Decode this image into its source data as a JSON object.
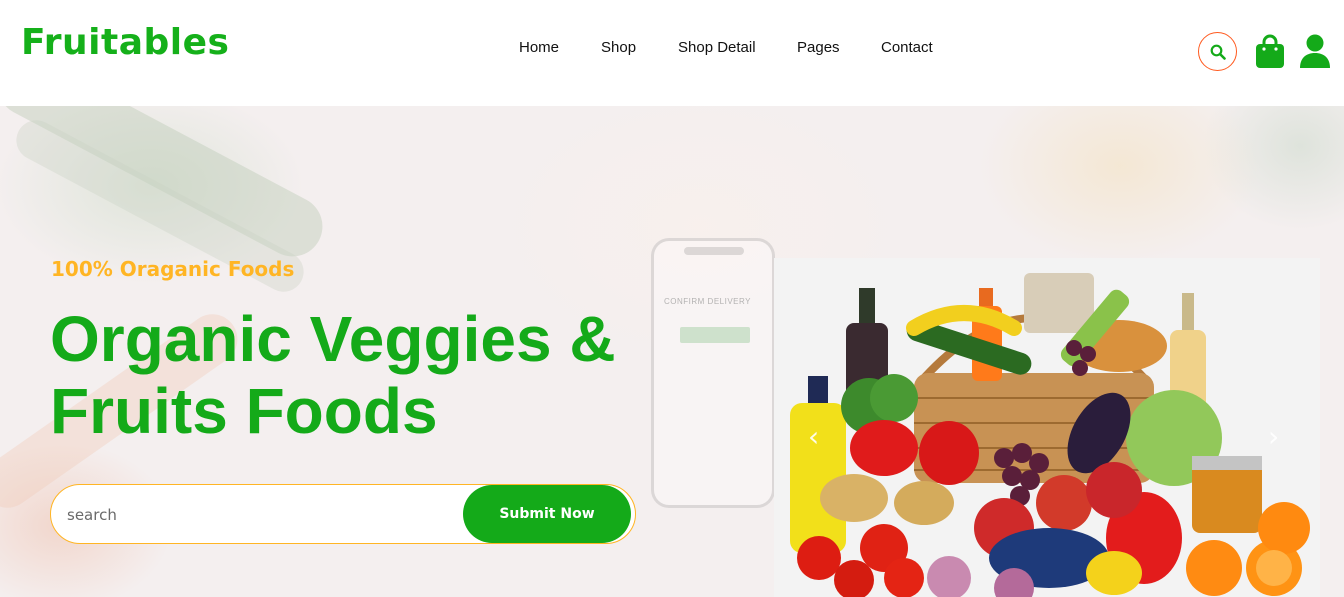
{
  "brand": {
    "name": "Fruitables",
    "color": "#15b01a"
  },
  "nav": {
    "items": [
      {
        "label": "Home"
      },
      {
        "label": "Shop"
      },
      {
        "label": "Shop Detail"
      },
      {
        "label": "Pages"
      },
      {
        "label": "Contact"
      }
    ]
  },
  "header_icons": {
    "search": "search-icon",
    "cart": "shopping-bag-icon",
    "account": "user-icon"
  },
  "hero": {
    "tagline": "100% Oraganic Foods",
    "headline_line1": "Organic Veggies &",
    "headline_line2": "Fruits Foods",
    "search_placeholder": "search",
    "submit_label": "Submit Now",
    "phone_text": "CONFIRM DELIVERY"
  },
  "carousel": {
    "prev": "‹",
    "next": "›"
  },
  "colors": {
    "primary": "#14aa19",
    "accent": "#ffb524",
    "search_ring": "#ff5a1f"
  }
}
